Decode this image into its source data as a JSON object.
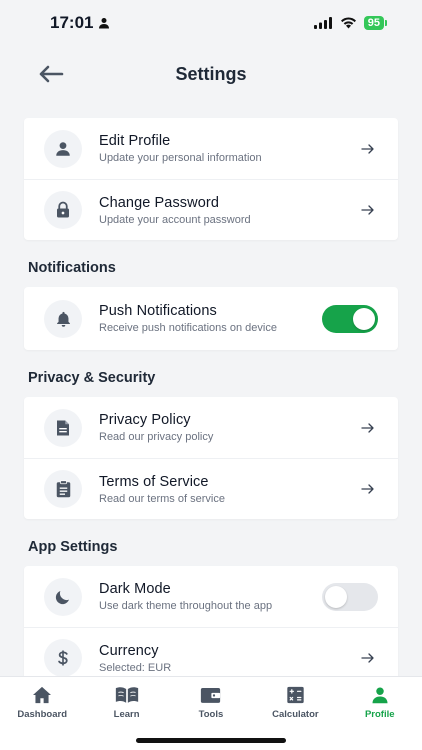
{
  "status_bar": {
    "time": "17:01",
    "battery": "95"
  },
  "header": {
    "title": "Settings"
  },
  "account": [
    {
      "title": "Edit Profile",
      "subtitle": "Update your personal information",
      "icon": "person-icon"
    },
    {
      "title": "Change Password",
      "subtitle": "Update your account password",
      "icon": "lock-icon"
    }
  ],
  "notifications": {
    "section_title": "Notifications",
    "push": {
      "title": "Push Notifications",
      "subtitle": "Receive push notifications on device",
      "enabled": true
    }
  },
  "privacy": {
    "section_title": "Privacy & Security",
    "items": [
      {
        "title": "Privacy Policy",
        "subtitle": "Read our privacy policy",
        "icon": "document-icon"
      },
      {
        "title": "Terms of Service",
        "subtitle": "Read our terms of service",
        "icon": "clipboard-icon"
      }
    ]
  },
  "app_settings": {
    "section_title": "App Settings",
    "dark_mode": {
      "title": "Dark Mode",
      "subtitle": "Use dark theme throughout the app",
      "enabled": false
    },
    "currency": {
      "title": "Currency",
      "subtitle": "Selected: EUR"
    }
  },
  "tabbar": {
    "items": [
      {
        "label": "Dashboard",
        "icon": "home-icon"
      },
      {
        "label": "Learn",
        "icon": "book-icon"
      },
      {
        "label": "Tools",
        "icon": "wallet-icon"
      },
      {
        "label": "Calculator",
        "icon": "calculator-icon"
      },
      {
        "label": "Profile",
        "icon": "person-icon",
        "active": true
      }
    ]
  },
  "colors": {
    "accent": "#16a34a",
    "background": "#f3f4f6",
    "icon": "#4b5563"
  }
}
